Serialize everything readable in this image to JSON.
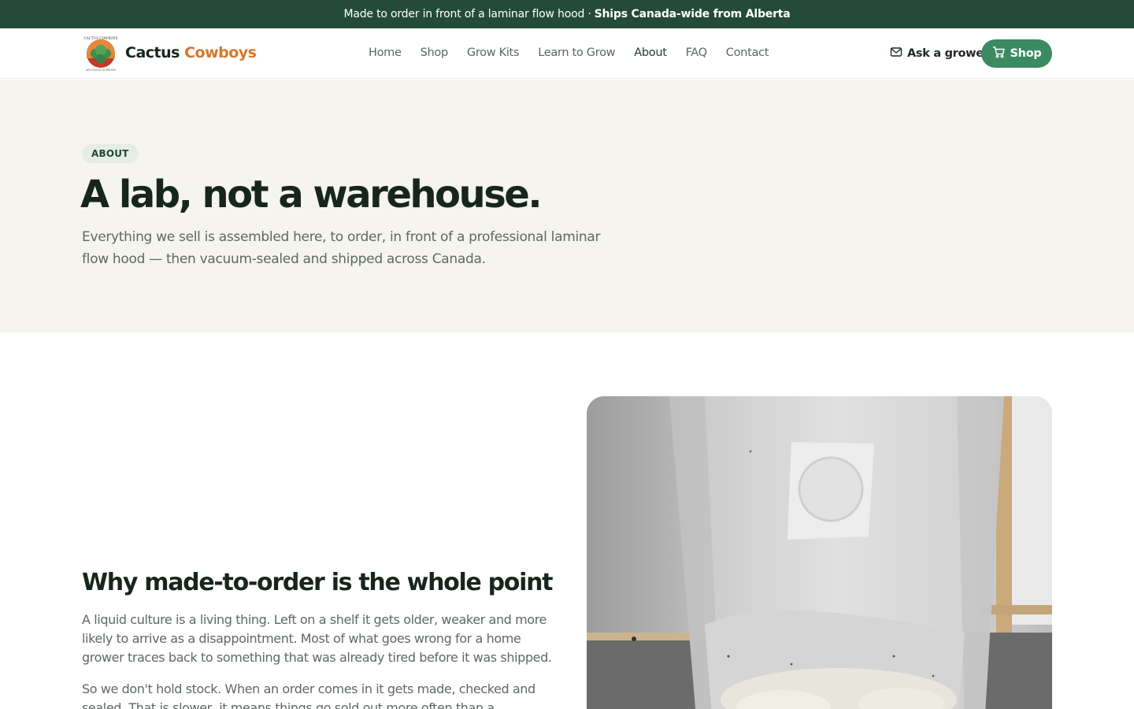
{
  "announcement": {
    "text": "Made to order in front of a laminar flow hood ·",
    "strong": "Ships Canada-wide from Alberta"
  },
  "header": {
    "brand_part1": "Cactus",
    "brand_part2": "Cowboys",
    "logo_text": "CACTUS COWBOYS",
    "logo_subtext": "MYCOLOGY SUPPLIES",
    "nav": [
      "Home",
      "Shop",
      "Grow Kits",
      "Learn to Grow",
      "About",
      "FAQ",
      "Contact"
    ],
    "active_nav": "About",
    "ask_label": "Ask a grower",
    "shop_label": "Shop"
  },
  "hero": {
    "badge": "ABOUT",
    "title": "A lab, not a warehouse.",
    "subtitle": "Everything we sell is assembled here, to order, in front of a professional laminar flow hood — then vacuum-sealed and shipped across Canada."
  },
  "section": {
    "title": "Why made-to-order is the whole point",
    "paragraphs": [
      "A liquid culture is a living thing. Left on a shelf it gets older, weaker and more likely to arrive as a disappointment. Most of what goes wrong for a home grower traces back to something that was already tired before it was shipped.",
      "So we don't hold stock. When an order comes in it gets made, checked and sealed. That is slower, it means things go sold out more often than a warehouse"
    ]
  },
  "colors": {
    "announcement_bg": "#244a3a",
    "accent_green": "#3b8a62",
    "brand_orange": "#d8772b",
    "hero_bg": "#f5f4ee"
  },
  "icons": [
    "mail-icon",
    "cart-icon"
  ]
}
